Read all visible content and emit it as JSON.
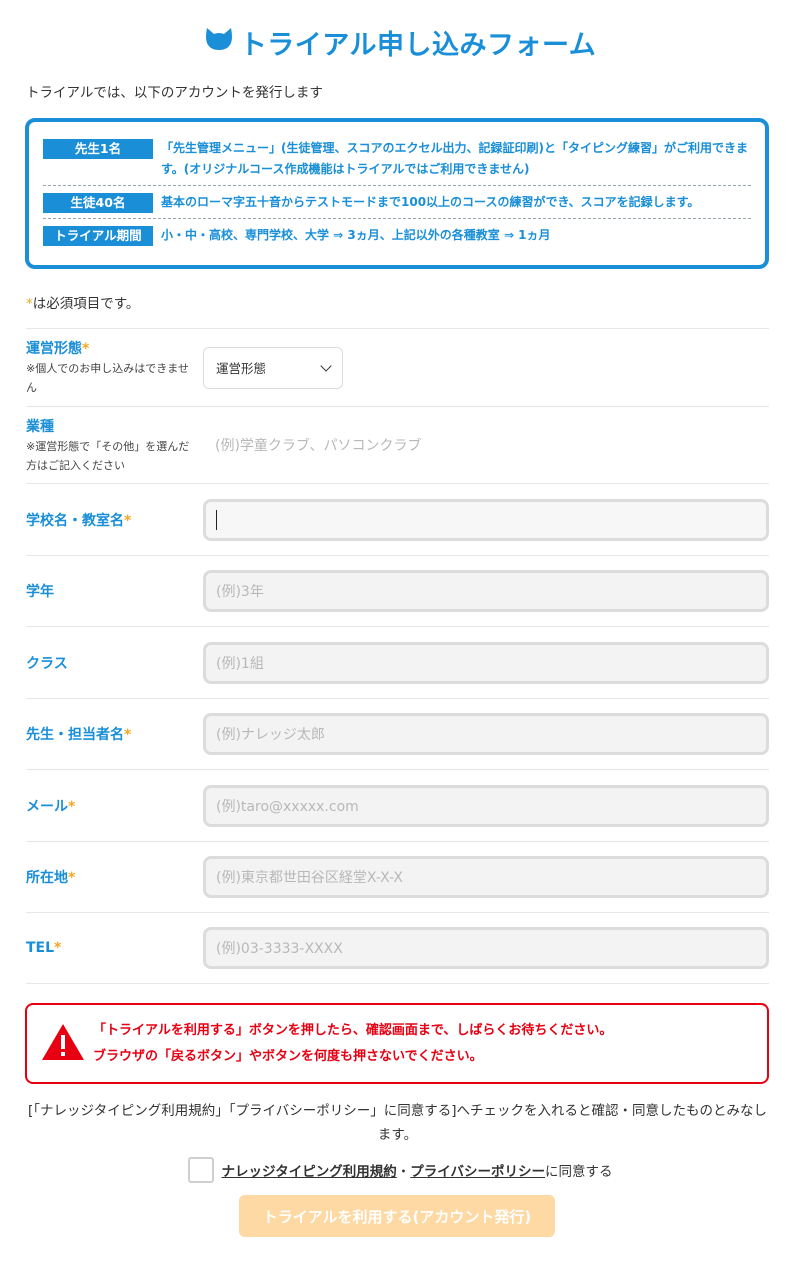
{
  "header": {
    "title": "トライアル申し込みフォーム",
    "intro": "トライアルでは、以下のアカウントを発行します"
  },
  "accounts": [
    {
      "tag": "先生1名",
      "text": "「先生管理メニュー」(生徒管理、スコアのエクセル出力、記録証印刷)と「タイピング練習」がご利用できます。(オリジナルコース作成機能はトライアルではご利用できません)"
    },
    {
      "tag": "生徒40名",
      "text": "基本のローマ字五十音からテストモードまで100以上のコースの練習ができ、スコアを記録します。"
    },
    {
      "tag": "トライアル期間",
      "text": "小・中・高校、専門学校、大学 ⇒ 3ヵ月、上記以外の各種教室 ⇒ 1ヵ月"
    }
  ],
  "required_note": {
    "star": "*",
    "text": "は必須項目です。"
  },
  "form": {
    "operation": {
      "label": "運営形態",
      "star": "*",
      "note": "※個人でのお申し込みはできません",
      "selected": "運営形態"
    },
    "industry": {
      "label": "業種",
      "note": "※運営形態で「その他」を選んだ方はご記入ください",
      "placeholder": "(例)学童クラブ、パソコンクラブ"
    },
    "school": {
      "label": "学校名・教室名",
      "star": "*",
      "value": ""
    },
    "grade": {
      "label": "学年",
      "placeholder": "(例)3年"
    },
    "class": {
      "label": "クラス",
      "placeholder": "(例)1組"
    },
    "teacher": {
      "label": "先生・担当者名",
      "star": "*",
      "placeholder": "(例)ナレッジ太郎"
    },
    "email": {
      "label": "メール",
      "star": "*",
      "placeholder": "(例)taro@xxxxx.com"
    },
    "address": {
      "label": "所在地",
      "star": "*",
      "placeholder": "(例)東京都世田谷区経堂X-X-X"
    },
    "tel": {
      "label": "TEL",
      "star": "*",
      "placeholder": "(例)03-3333-XXXX"
    }
  },
  "warning": {
    "line1": "「トライアルを利用する」ボタンを押したら、確認画面まで、しばらくお待ちください。",
    "line2": "ブラウザの「戻るボタン」やボタンを何度も押さないでください。",
    "icon": "warning-icon"
  },
  "agreement": {
    "text": "[「ナレッジタイピング利用規約」「プライバシーポリシー」に同意する]へチェックを入れると確認・同意したものとみなします。",
    "terms_link": "ナレッジタイピング利用規約",
    "sep": "・",
    "privacy_link": "プライバシーポリシー",
    "suffix": "に同意する",
    "checked": false
  },
  "submit_label": "トライアルを利用する(アカウント発行)",
  "colors": {
    "accent": "#1a8fd8",
    "required": "#f5a623",
    "warning": "#e60012",
    "button": "#fed9a3"
  }
}
